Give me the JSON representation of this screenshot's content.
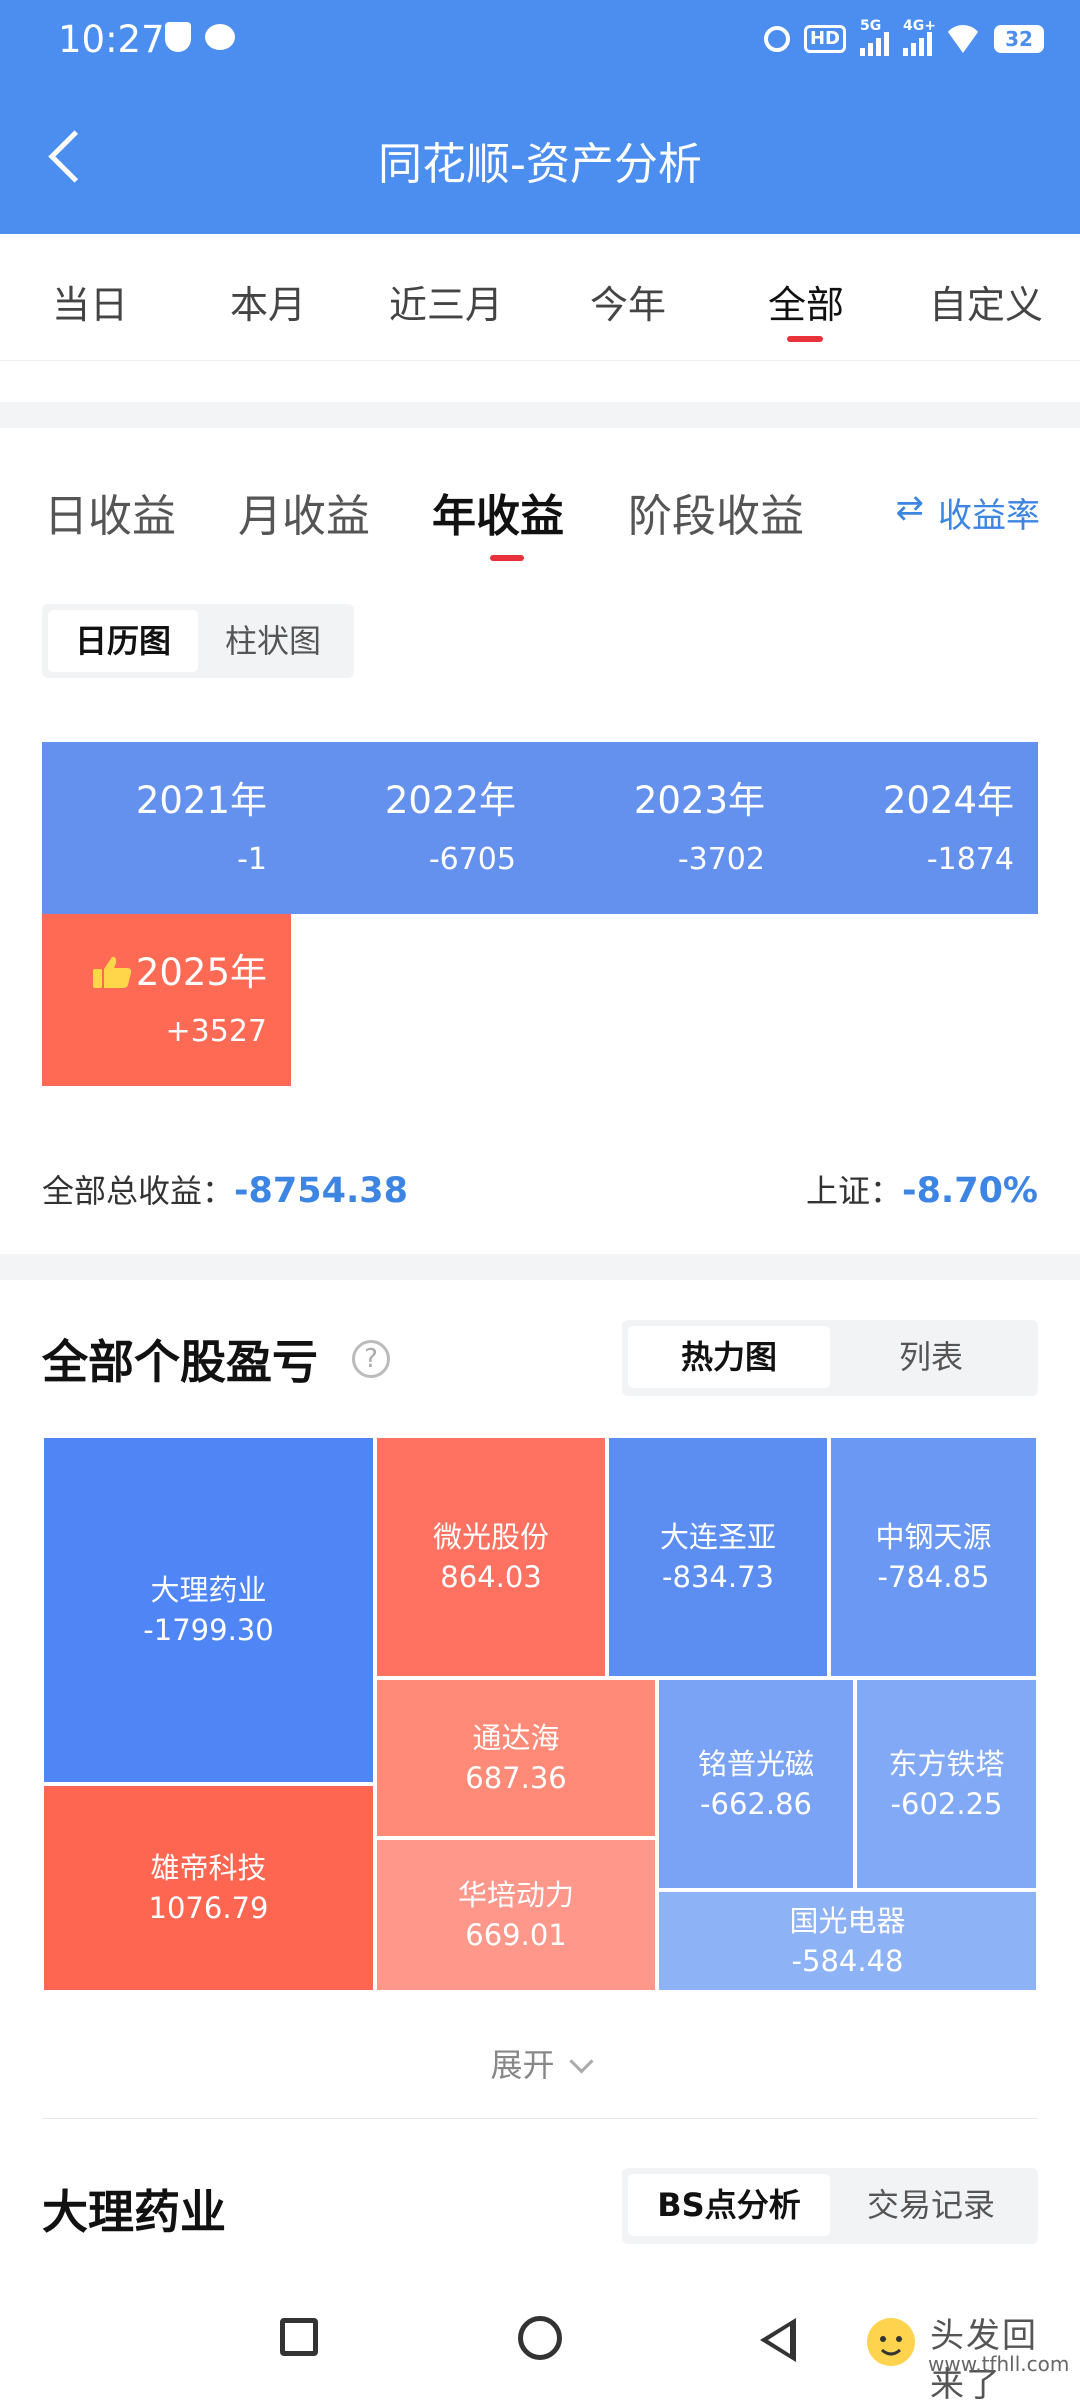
{
  "status_bar": {
    "time": "10:27",
    "network_labels": [
      "HD",
      "5G",
      "4G+"
    ],
    "battery": "32"
  },
  "header": {
    "title": "同花顺-资产分析",
    "back_icon": "chevron-left-icon"
  },
  "period_tabs": [
    "当日",
    "本月",
    "近三月",
    "今年",
    "全部",
    "自定义"
  ],
  "period_active": "全部",
  "returns": {
    "tabs": [
      "日收益",
      "月收益",
      "年收益",
      "阶段收益"
    ],
    "active_tab": "年收益",
    "rate_label": "收益率",
    "rate_icon": "swap-arrows-icon",
    "view_toggle": [
      "日历图",
      "柱状图"
    ],
    "view_active": "日历图",
    "years": [
      {
        "year": "2021年",
        "value": "-1"
      },
      {
        "year": "2022年",
        "value": "-6705"
      },
      {
        "year": "2023年",
        "value": "-3702"
      },
      {
        "year": "2024年",
        "value": "-1874"
      },
      {
        "year": "2025年",
        "value": "+3527",
        "badge_icon": "thumbs-up-icon"
      }
    ],
    "total_label": "全部总收益：",
    "total_value": "-8754.38",
    "index_label": "上证：",
    "index_value": "-8.70%"
  },
  "stocks": {
    "title": "全部个股盈亏",
    "help_icon": "question-circle-icon",
    "view_toggle": [
      "热力图",
      "列表"
    ],
    "view_active": "热力图",
    "tiles": [
      {
        "name": "大理药业",
        "value": "-1799.30"
      },
      {
        "name": "雄帝科技",
        "value": "1076.79"
      },
      {
        "name": "微光股份",
        "value": "864.03"
      },
      {
        "name": "通达海",
        "value": "687.36"
      },
      {
        "name": "华培动力",
        "value": "669.01"
      },
      {
        "name": "大连圣亚",
        "value": "-834.73"
      },
      {
        "name": "中钢天源",
        "value": "-784.85"
      },
      {
        "name": "铭普光磁",
        "value": "-662.86"
      },
      {
        "name": "东方铁塔",
        "value": "-602.25"
      },
      {
        "name": "国光电器",
        "value": "-584.48"
      }
    ],
    "expand_label": "展开"
  },
  "detail": {
    "title": "大理药业",
    "toggle": [
      "BS点分析",
      "交易记录"
    ],
    "active": "BS点分析"
  },
  "watermark": {
    "line1": "头发回来了",
    "line2": "www.tfhll.com"
  },
  "colors": {
    "header_blue": "#4b8ef0",
    "accent_red": "#e8313b",
    "link_blue": "#3d85e3",
    "gain_red": "#ff6a55",
    "loss_blue": "#5c8ef2"
  }
}
